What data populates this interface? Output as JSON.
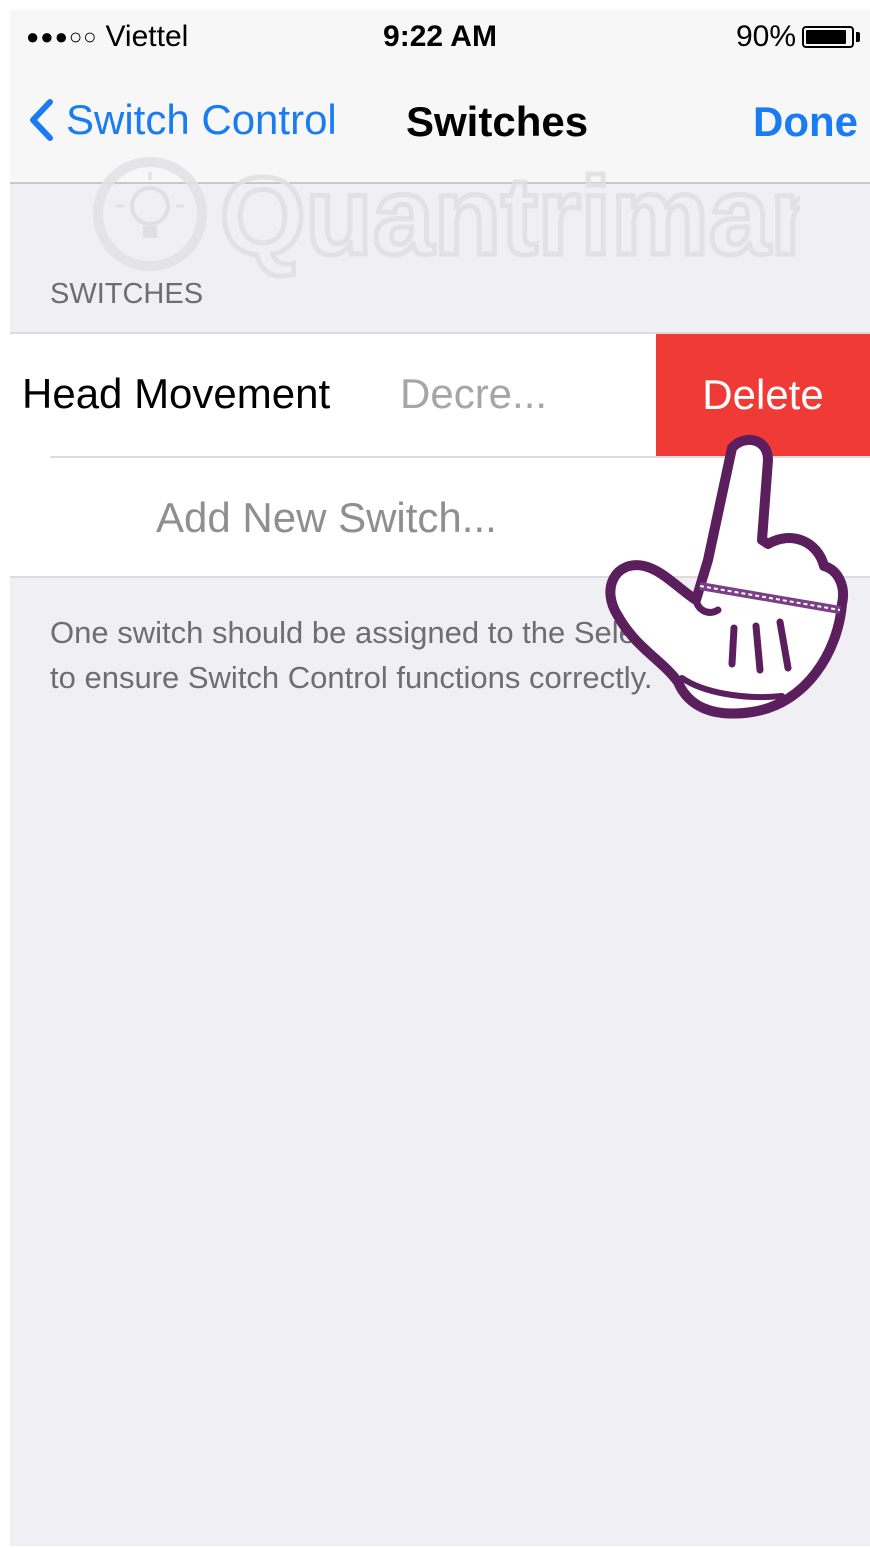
{
  "status_bar": {
    "signal": "●●●○○",
    "carrier": "Viettel",
    "time": "9:22 AM",
    "battery": "90%",
    "battery_level": 0.9
  },
  "nav": {
    "back_label": "Switch Control",
    "title": "Switches",
    "done_label": "Done"
  },
  "watermark": {
    "text": "Quantrimang"
  },
  "section": {
    "header": "SWITCHES",
    "rows": [
      {
        "label": "Head Movement",
        "detail": "Decre...",
        "action": "Delete"
      },
      {
        "label": "Add New Switch..."
      }
    ],
    "footer": "One switch should be assigned to the Select Item action to ensure Switch Control functions correctly."
  },
  "colors": {
    "accent": "#1a7cf2",
    "delete": "#f03a35",
    "background": "#efeff4"
  }
}
